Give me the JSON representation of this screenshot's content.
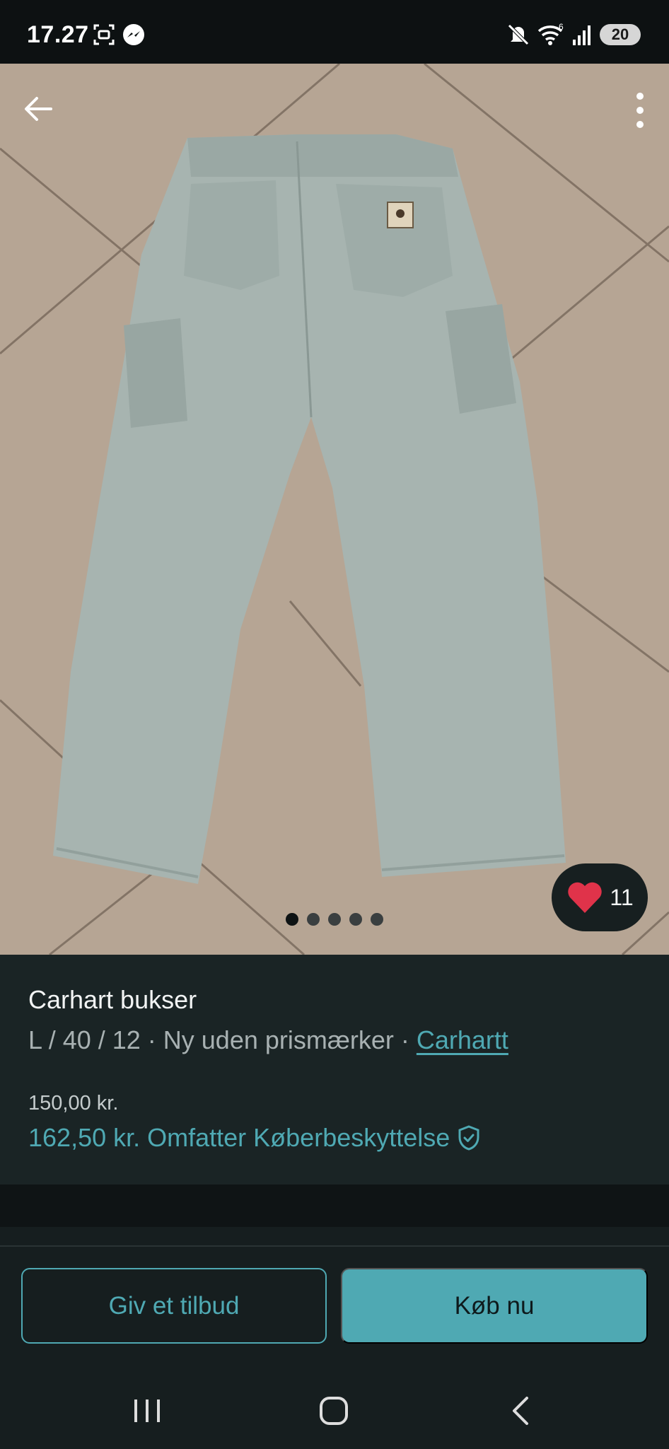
{
  "status_bar": {
    "time": "17.27",
    "battery": "20",
    "icons": [
      "screenshot-icon",
      "messenger-icon",
      "mute-icon",
      "wifi-icon",
      "signal-icon",
      "battery-icon"
    ]
  },
  "listing": {
    "title": "Carhart bukser",
    "details": "L / 40 / 12 · Ny uden prismærker · ",
    "brand": "Carhartt",
    "price": "150,00 kr.",
    "total_price": "162,50 kr.",
    "protection_label": "Omfatter Køberbeskyttelse",
    "likes": "11",
    "photo_count": 5,
    "current_photo": 1
  },
  "actions": {
    "offer_label": "Giv et tilbud",
    "buy_label": "Køb nu"
  },
  "colors": {
    "accent": "#4fa9b3",
    "background": "#161e1f",
    "like_heart": "#e0334a"
  }
}
